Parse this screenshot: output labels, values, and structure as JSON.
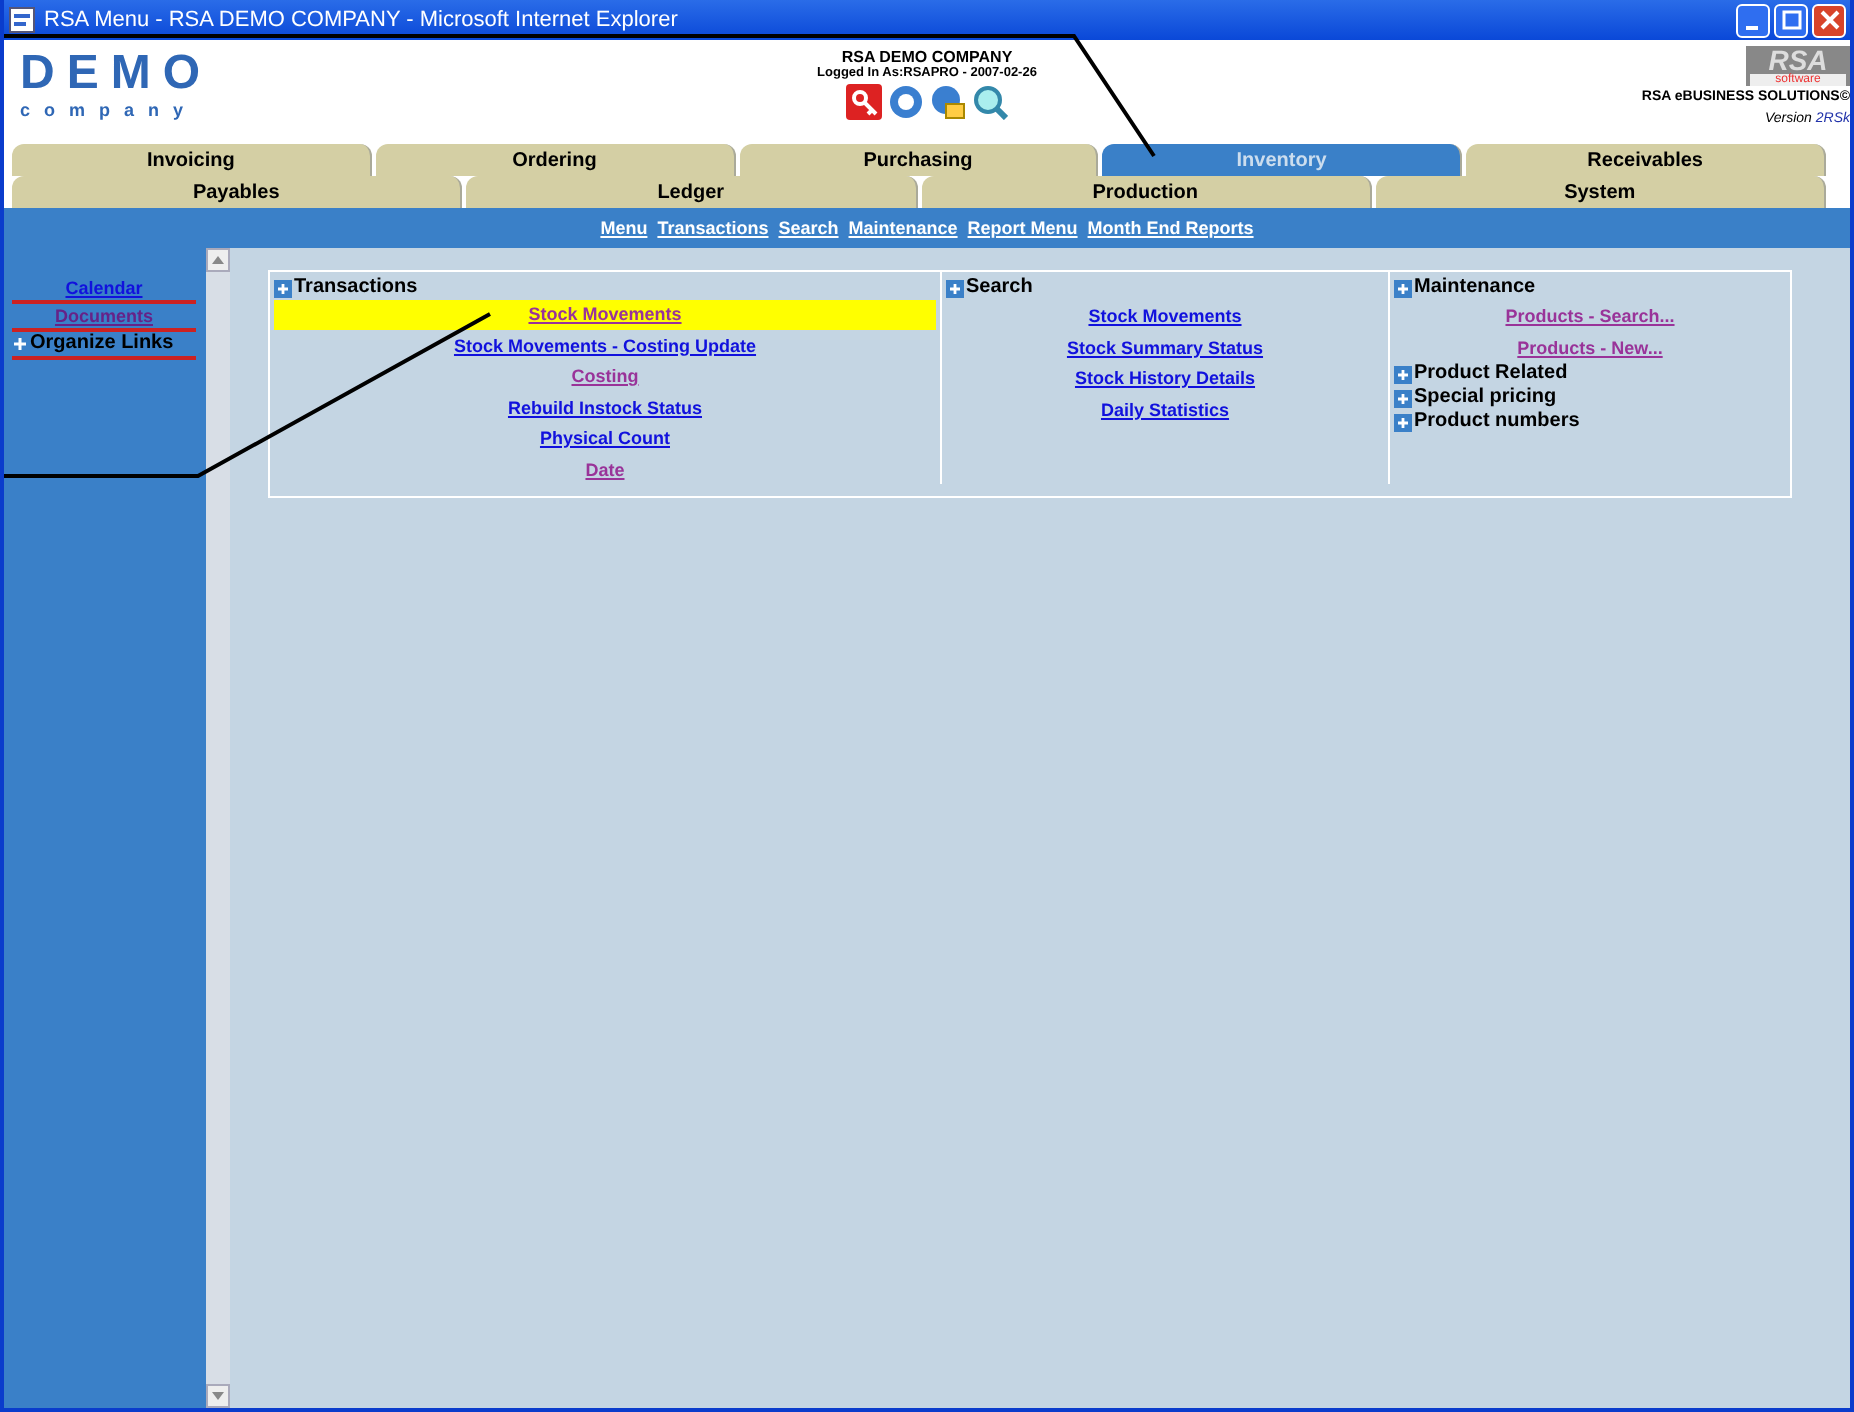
{
  "window": {
    "title": "RSA Menu - RSA DEMO COMPANY - Microsoft Internet Explorer"
  },
  "header": {
    "logo_main": "DEMO",
    "logo_sub": "company",
    "company": "RSA DEMO COMPANY",
    "logged_in": "Logged In As:RSAPRO - 2007-02-26",
    "brand_logo": "RSA",
    "brand_sub": "software",
    "brand": "RSA eBUSINESS SOLUTIONS©",
    "version_label": "Version",
    "version": "2RSk"
  },
  "tabs_top": [
    {
      "label": "Invoicing",
      "selected": false
    },
    {
      "label": "Ordering",
      "selected": false
    },
    {
      "label": "Purchasing",
      "selected": false
    },
    {
      "label": "Inventory",
      "selected": true
    },
    {
      "label": "Receivables",
      "selected": false
    }
  ],
  "tabs_bottom": [
    {
      "label": "Payables",
      "selected": false
    },
    {
      "label": "Ledger",
      "selected": false
    },
    {
      "label": "Production",
      "selected": false
    },
    {
      "label": "System",
      "selected": false
    }
  ],
  "nav_links": [
    "Menu",
    "Transactions",
    "Search",
    "Maintenance",
    "Report Menu",
    "Month End Reports"
  ],
  "sidebar": [
    {
      "label": "Calendar",
      "kind": "link",
      "visited": false
    },
    {
      "label": "Documents",
      "kind": "link",
      "visited": true
    },
    {
      "label": "Organize Links",
      "kind": "group"
    }
  ],
  "panels": [
    {
      "title": "Transactions",
      "items": [
        {
          "kind": "link",
          "label": "Stock Movements",
          "visited": true,
          "highlighted": true
        },
        {
          "kind": "link",
          "label": "Stock Movements - Costing Update",
          "visited": false,
          "highlighted": false
        },
        {
          "kind": "link",
          "label": "Costing",
          "visited": true,
          "highlighted": false
        },
        {
          "kind": "link",
          "label": "Rebuild Instock Status",
          "visited": false,
          "highlighted": false
        },
        {
          "kind": "link",
          "label": "Physical Count",
          "visited": false,
          "highlighted": false
        },
        {
          "kind": "link",
          "label": "Date",
          "visited": true,
          "highlighted": false
        }
      ]
    },
    {
      "title": "Search",
      "items": [
        {
          "kind": "link",
          "label": "Stock Movements",
          "visited": false,
          "highlighted": false
        },
        {
          "kind": "link",
          "label": "Stock Summary Status",
          "visited": false,
          "highlighted": false
        },
        {
          "kind": "link",
          "label": "Stock History Details",
          "visited": false,
          "highlighted": false
        },
        {
          "kind": "link",
          "label": "Daily Statistics",
          "visited": false,
          "highlighted": false
        }
      ]
    },
    {
      "title": "Maintenance",
      "items": [
        {
          "kind": "link",
          "label": "Products - Search...",
          "visited": true,
          "highlighted": false
        },
        {
          "kind": "link",
          "label": "Products - New...",
          "visited": true,
          "highlighted": false
        },
        {
          "kind": "group",
          "label": "Product Related"
        },
        {
          "kind": "group",
          "label": "Special pricing"
        },
        {
          "kind": "group",
          "label": "Product numbers"
        }
      ]
    }
  ]
}
